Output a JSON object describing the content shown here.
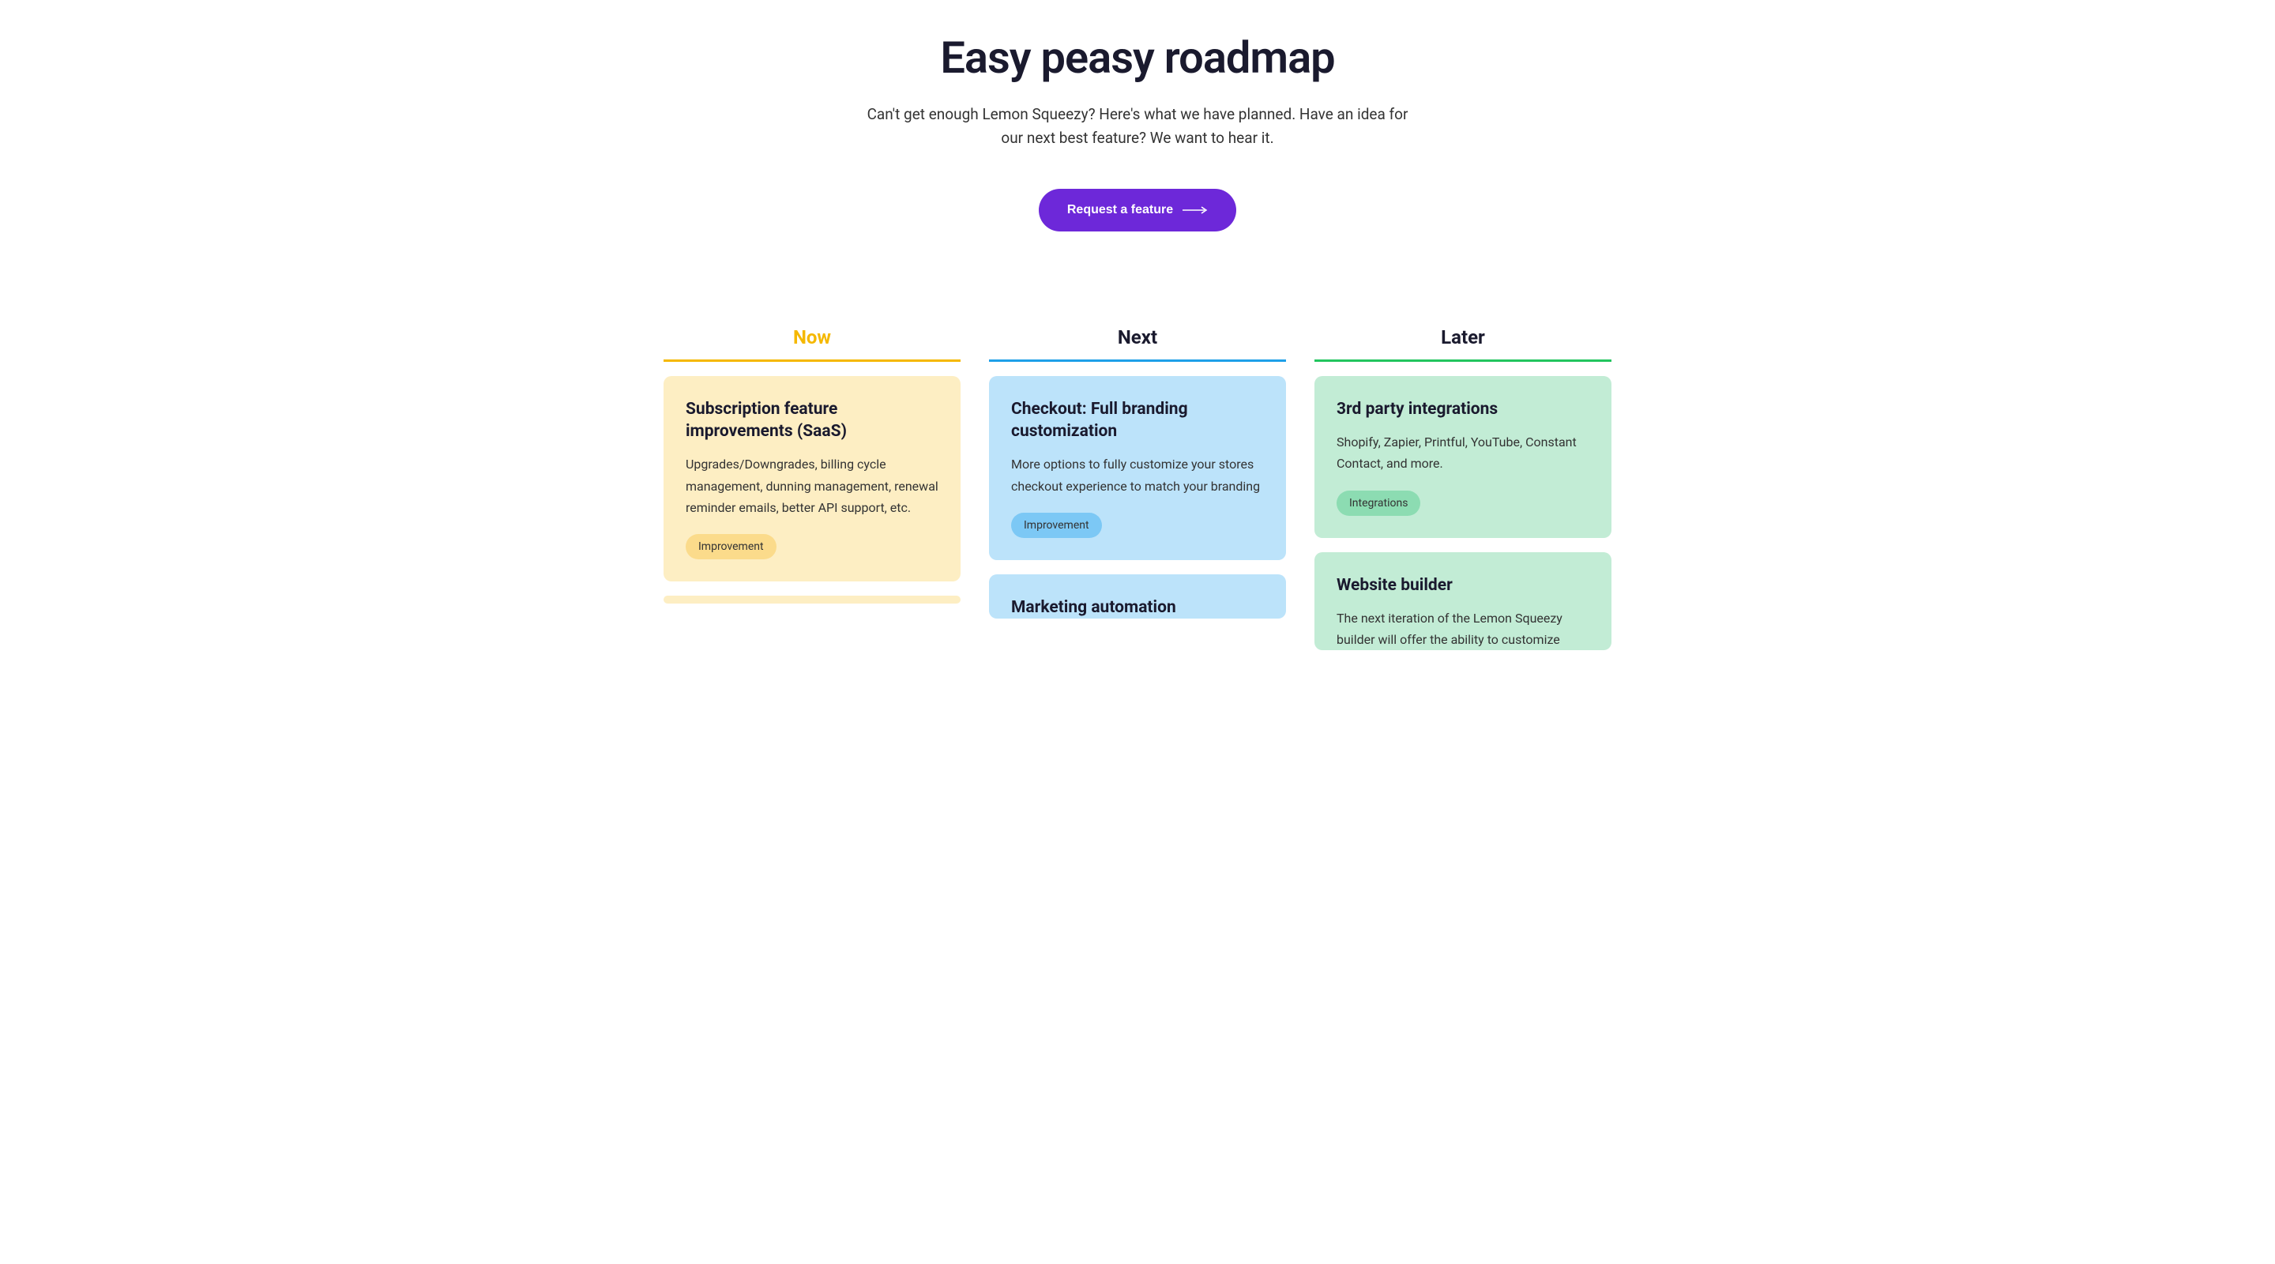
{
  "header": {
    "title": "Easy peasy roadmap",
    "subtitle": "Can't get enough Lemon Squeezy? Here's what we have planned. Have an idea for our next best feature? We want to hear it.",
    "cta_label": "Request a feature"
  },
  "columns": {
    "now": {
      "label": "Now",
      "cards": [
        {
          "title": "Subscription feature improvements (SaaS)",
          "desc": "Upgrades/Downgrades, billing cycle management, dunning management, renewal reminder emails, better API support, etc.",
          "tag": "Improvement"
        }
      ]
    },
    "next": {
      "label": "Next",
      "cards": [
        {
          "title": "Checkout: Full branding customization",
          "desc": "More options to fully customize your stores checkout experience to match your branding",
          "tag": "Improvement"
        },
        {
          "title": "Marketing automation"
        }
      ]
    },
    "later": {
      "label": "Later",
      "cards": [
        {
          "title": "3rd party integrations",
          "desc": "Shopify, Zapier, Printful, YouTube, Constant Contact, and more.",
          "tag": "Integrations"
        },
        {
          "title": "Website builder",
          "desc": "The next iteration of the Lemon Squeezy builder will offer the ability to customize"
        }
      ]
    }
  }
}
